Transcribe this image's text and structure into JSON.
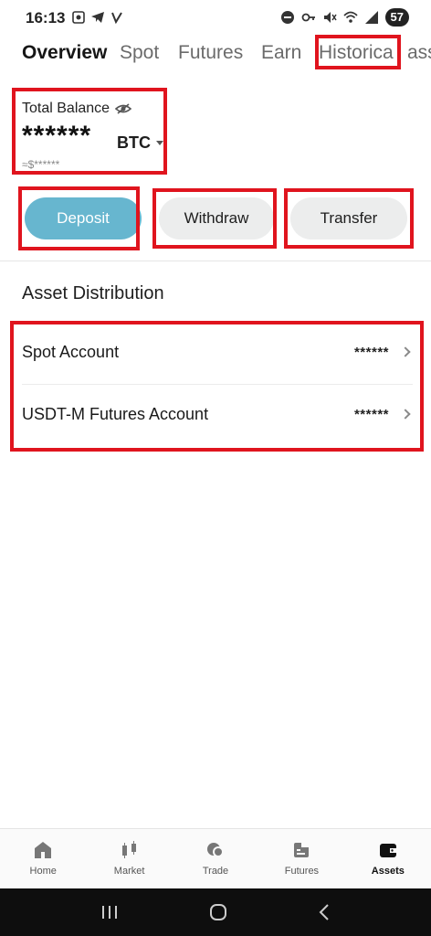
{
  "status": {
    "time": "16:13",
    "battery": "57"
  },
  "tabs": [
    {
      "label": "Overview"
    },
    {
      "label": "Spot"
    },
    {
      "label": "Futures"
    },
    {
      "label": "Earn"
    },
    {
      "label": "Historica"
    },
    {
      "label": "ass"
    }
  ],
  "balance": {
    "label": "Total Balance",
    "value": "******",
    "currency": "BTC",
    "fiat": "≈$******",
    "visibility_icon": "eye-off-icon"
  },
  "actions": {
    "deposit": "Deposit",
    "withdraw": "Withdraw",
    "transfer": "Transfer"
  },
  "distribution": {
    "title": "Asset Distribution",
    "accounts": [
      {
        "name": "Spot Account",
        "value": "******"
      },
      {
        "name": "USDT-M Futures Account",
        "value": "******"
      }
    ]
  },
  "bottom_nav": [
    {
      "label": "Home",
      "icon": "home-icon"
    },
    {
      "label": "Market",
      "icon": "candlestick-icon"
    },
    {
      "label": "Trade",
      "icon": "trade-icon"
    },
    {
      "label": "Futures",
      "icon": "futures-icon"
    },
    {
      "label": "Assets",
      "icon": "wallet-icon"
    }
  ],
  "colors": {
    "deposit_button": "#67b6cf",
    "highlight": "#e0141e"
  }
}
